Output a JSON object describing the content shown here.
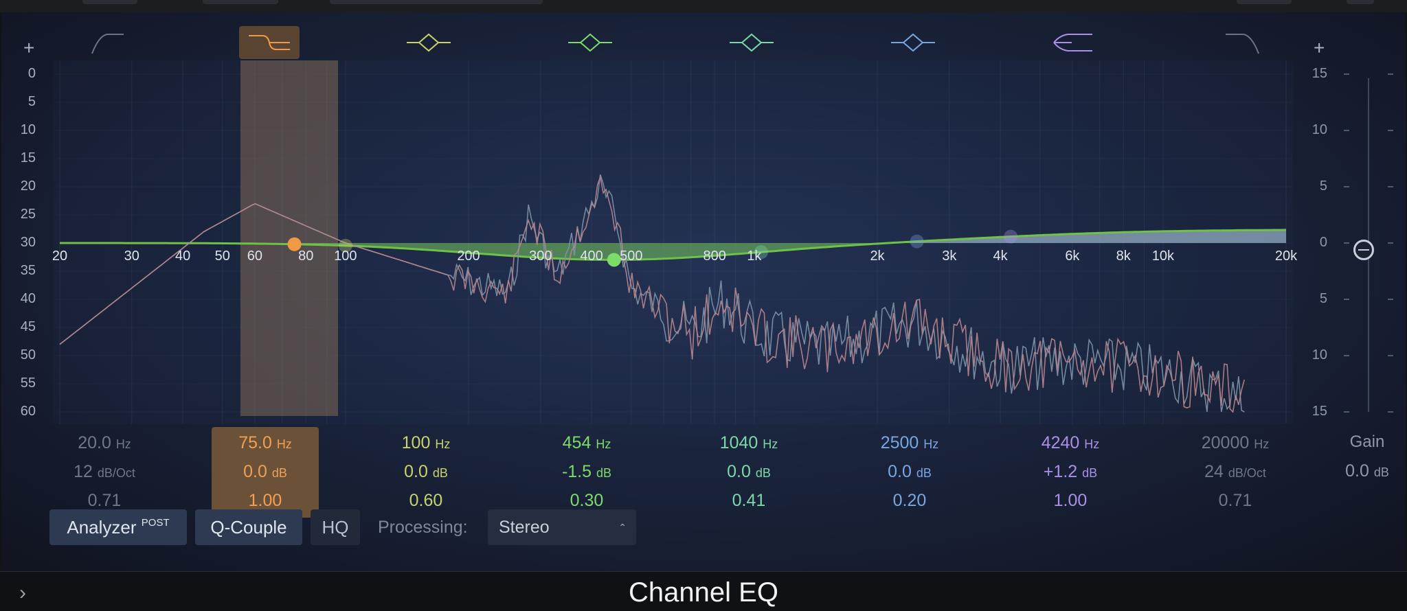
{
  "app": {
    "title": "Channel EQ"
  },
  "colors": {
    "orange": "#f09a45",
    "yellow": "#c7d36a",
    "green": "#7ddb6a",
    "mint": "#7ad9a6",
    "blue": "#77a6e0",
    "purple": "#a990e6",
    "gray": "#6c7484",
    "curve": "#6fc247",
    "analyzer": "#b8868e",
    "analyzer2": "#7e93a8"
  },
  "left_axis": {
    "labels": [
      "0",
      "5",
      "10",
      "15",
      "20",
      "25",
      "30",
      "35",
      "40",
      "45",
      "50",
      "55",
      "60"
    ]
  },
  "right_axis": {
    "labels": [
      "15",
      "10",
      "5",
      "0",
      "5",
      "10",
      "15"
    ]
  },
  "freq_axis": {
    "labels": [
      "20",
      "30",
      "40",
      "50",
      "60",
      "80",
      "100",
      "200",
      "300",
      "400",
      "500",
      "800",
      "1k",
      "2k",
      "3k",
      "4k",
      "6k",
      "8k",
      "10k",
      "20k"
    ]
  },
  "bands": [
    {
      "name": "lowcut",
      "icon": "low-cut-icon",
      "color": "#6c7484",
      "freq": "20.0",
      "freq_unit": "Hz",
      "gain": "12",
      "gain_unit": "dB/Oct",
      "q": "0.71",
      "selected": false
    },
    {
      "name": "lowshelf",
      "icon": "low-shelf-icon",
      "color": "#f09a45",
      "freq": "75.0",
      "freq_unit": "Hz",
      "gain": "0.0",
      "gain_unit": "dB",
      "q": "1.00",
      "selected": true
    },
    {
      "name": "band1",
      "icon": "bell-band-icon",
      "color": "#c7d36a",
      "freq": "100",
      "freq_unit": "Hz",
      "gain": "0.0",
      "gain_unit": "dB",
      "q": "0.60",
      "selected": false
    },
    {
      "name": "band2",
      "icon": "bell-band-icon",
      "color": "#7ddb6a",
      "freq": "454",
      "freq_unit": "Hz",
      "gain": "-1.5",
      "gain_unit": "dB",
      "q": "0.30",
      "selected": false
    },
    {
      "name": "band3",
      "icon": "bell-band-icon",
      "color": "#7ad9a6",
      "freq": "1040",
      "freq_unit": "Hz",
      "gain": "0.0",
      "gain_unit": "dB",
      "q": "0.41",
      "selected": false
    },
    {
      "name": "band4",
      "icon": "bell-band-icon",
      "color": "#77a6e0",
      "freq": "2500",
      "freq_unit": "Hz",
      "gain": "0.0",
      "gain_unit": "dB",
      "q": "0.20",
      "selected": false
    },
    {
      "name": "highshelf",
      "icon": "high-shelf-icon",
      "color": "#a990e6",
      "freq": "4240",
      "freq_unit": "Hz",
      "gain": "+1.2",
      "gain_unit": "dB",
      "q": "1.00",
      "selected": false
    },
    {
      "name": "highcut",
      "icon": "high-cut-icon",
      "color": "#6c7484",
      "freq": "20000",
      "freq_unit": "Hz",
      "gain": "24",
      "gain_unit": "dB/Oct",
      "q": "0.71",
      "selected": false
    }
  ],
  "gain": {
    "label": "Gain",
    "value": "0.0",
    "unit": "dB",
    "level": 0.0
  },
  "controls": {
    "analyzer_label": "Analyzer",
    "analyzer_sup": "POST",
    "qcouple_label": "Q-Couple",
    "hq_label": "HQ",
    "processing_label": "Processing:",
    "processing_value": "Stereo"
  },
  "plus_icon": "+",
  "footer": {
    "expand_icon": "chevron-right-icon",
    "expand_glyph": "›"
  }
}
